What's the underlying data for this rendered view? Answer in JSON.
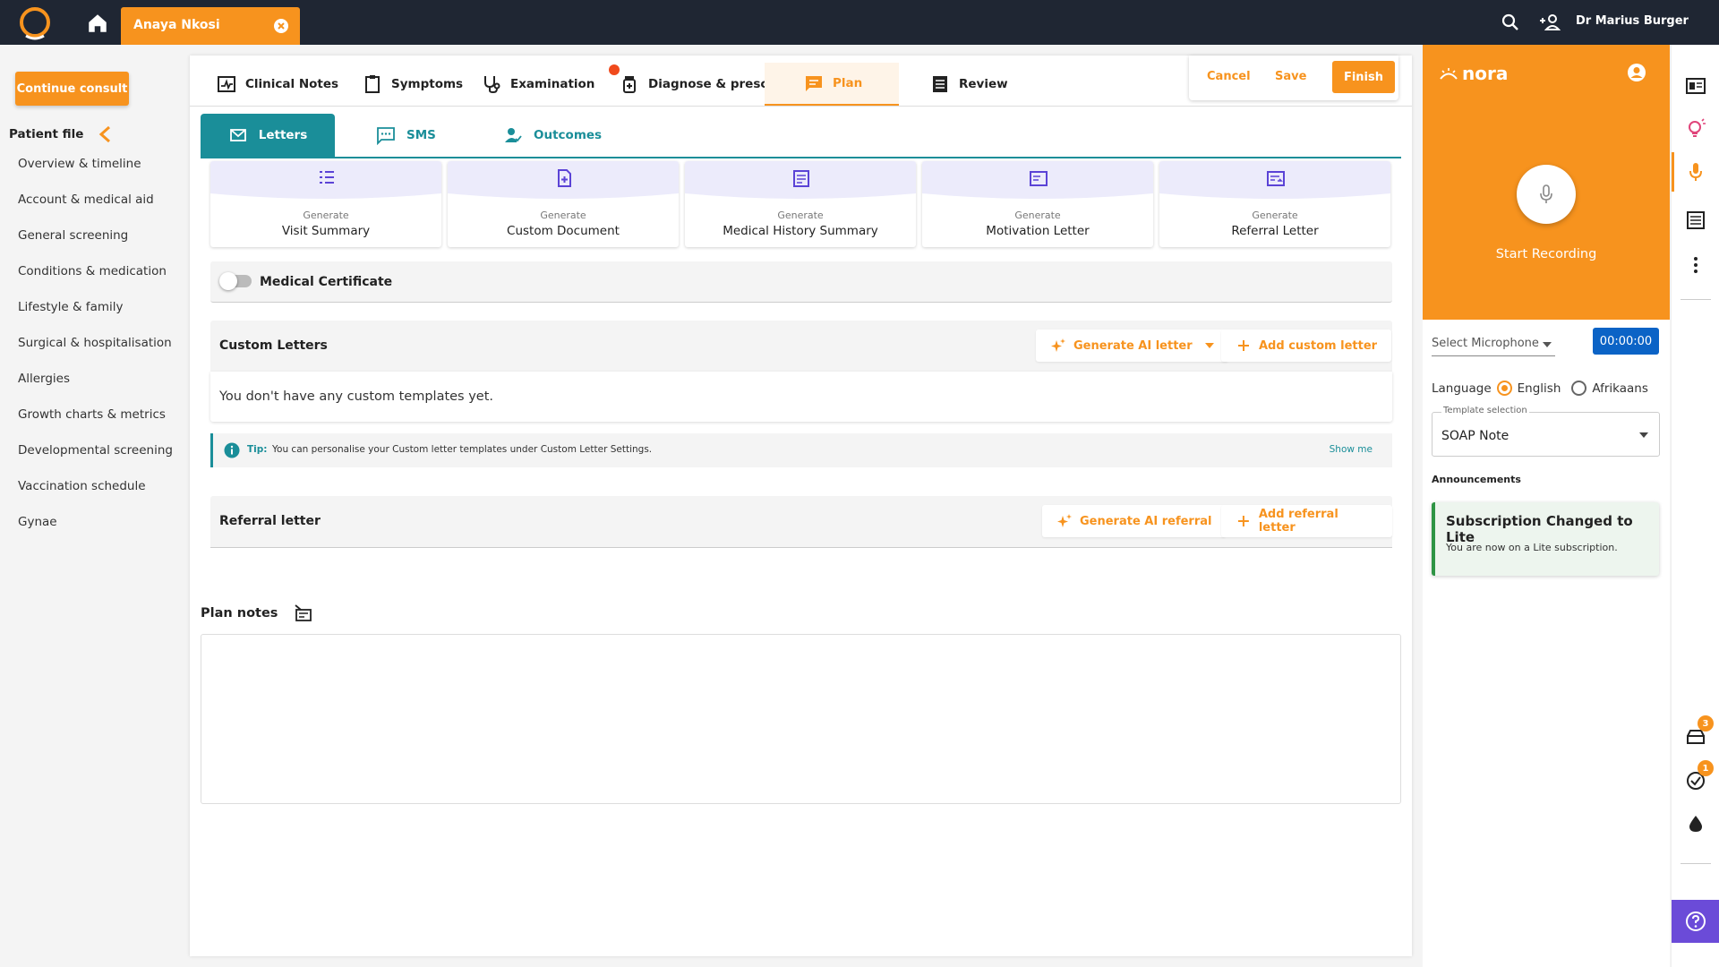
{
  "topbar": {
    "patient_name": "Anaya Nkosi",
    "user_name": "Dr Marius Burger"
  },
  "sidebar": {
    "continue_label": "Continue consult",
    "patient_file_label": "Patient file",
    "items": [
      {
        "label": "Overview & timeline"
      },
      {
        "label": "Account & medical aid"
      },
      {
        "label": "General screening"
      },
      {
        "label": "Conditions & medication"
      },
      {
        "label": "Lifestyle & family"
      },
      {
        "label": "Surgical & hospitalisation"
      },
      {
        "label": "Allergies"
      },
      {
        "label": "Growth charts & metrics"
      },
      {
        "label": "Developmental screening"
      },
      {
        "label": "Vaccination schedule"
      },
      {
        "label": "Gynae"
      }
    ]
  },
  "tabs": [
    {
      "label": "Clinical Notes",
      "icon": "clipboard-pulse-icon"
    },
    {
      "label": "Symptoms",
      "icon": "clipboard-icon"
    },
    {
      "label": "Examination",
      "icon": "stethoscope-icon"
    },
    {
      "label": "Diagnose & prescribe",
      "icon": "medicine-bottle-icon"
    },
    {
      "label": "Plan",
      "icon": "chat-icon"
    },
    {
      "label": "Review",
      "icon": "list-icon"
    }
  ],
  "actions": {
    "cancel": "Cancel",
    "save": "Save",
    "finish": "Finish"
  },
  "subtabs": [
    {
      "label": "Letters"
    },
    {
      "label": "SMS"
    },
    {
      "label": "Outcomes"
    }
  ],
  "generate_cards": [
    {
      "small": "Generate",
      "title": "Visit Summary"
    },
    {
      "small": "Generate",
      "title": "Custom Document"
    },
    {
      "small": "Generate",
      "title": "Medical History Summary"
    },
    {
      "small": "Generate",
      "title": "Motivation Letter"
    },
    {
      "small": "Generate",
      "title": "Referral Letter"
    }
  ],
  "medical_certificate": {
    "label": "Medical Certificate",
    "enabled": false
  },
  "custom_letters": {
    "title": "Custom Letters",
    "ai_button": "Generate AI letter",
    "add_button": "Add custom letter",
    "empty_text": "You don't have any custom templates yet."
  },
  "tip": {
    "label": "Tip:",
    "text": "You can personalise your Custom letter templates under Custom Letter Settings.",
    "link": "Show me"
  },
  "referral": {
    "title": "Referral letter",
    "ai_button": "Generate AI referral",
    "add_button": "Add referral letter"
  },
  "plan_notes": {
    "label": "Plan notes",
    "value": ""
  },
  "nora": {
    "brand": "nora",
    "start_recording": "Start Recording",
    "select_microphone": "Select Microphone",
    "timer": "00:00:00",
    "language_label": "Language",
    "languages": [
      {
        "label": "English",
        "selected": true
      },
      {
        "label": "Afrikaans",
        "selected": false
      }
    ],
    "template_label": "Template selection",
    "template_value": "SOAP Note",
    "announcements_label": "Announcements",
    "announcement": {
      "title": "Subscription Changed to Lite",
      "body": "You are now on a Lite subscription."
    }
  },
  "rail": {
    "badges": [
      "3",
      "1"
    ]
  },
  "colors": {
    "brand_orange": "#f7931e",
    "teal": "#1a8e99",
    "topbar": "#1f2633",
    "timer_blue": "#0b63c6",
    "help_purple": "#6b4bd8",
    "announcement_green": "#2e9444"
  }
}
